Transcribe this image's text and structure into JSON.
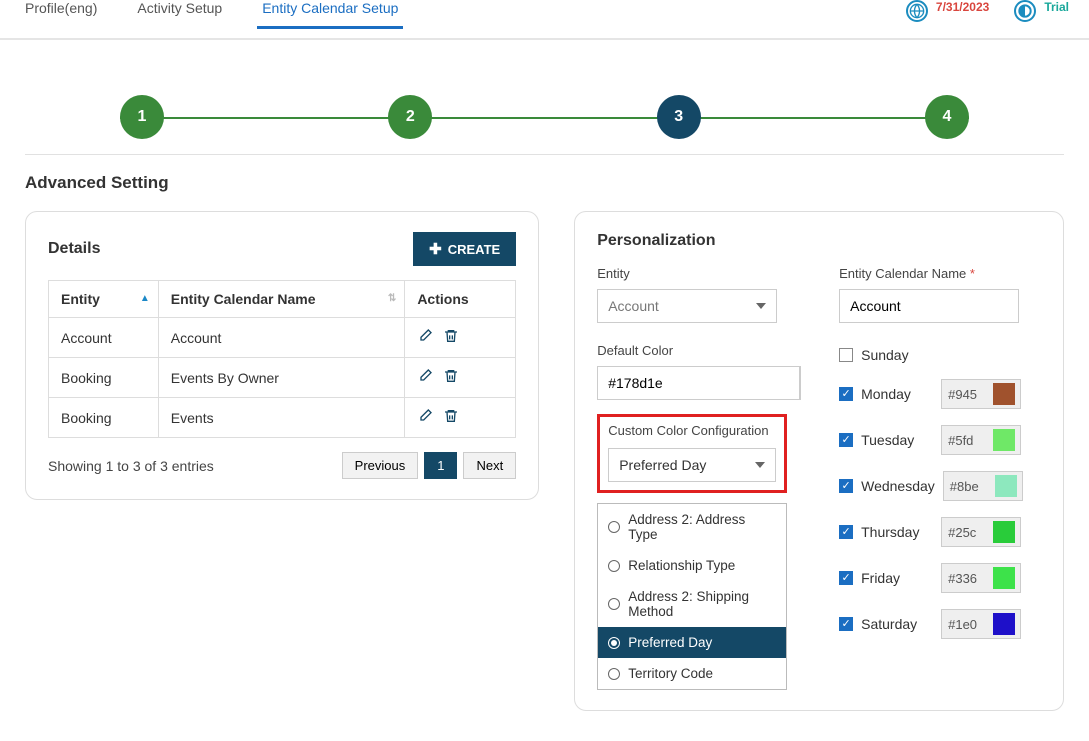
{
  "tabs": {
    "profile": "Profile(eng)",
    "activity": "Activity Setup",
    "entity": "Entity Calendar Setup"
  },
  "status": {
    "expires_value": "7/31/2023",
    "status_value": "Trial"
  },
  "steps": [
    "1",
    "2",
    "3",
    "4"
  ],
  "section_title": "Advanced Setting",
  "details": {
    "heading": "Details",
    "create_btn": "CREATE",
    "cols": {
      "entity": "Entity",
      "calname": "Entity Calendar Name",
      "actions": "Actions"
    },
    "rows": [
      {
        "entity": "Account",
        "cal": "Account"
      },
      {
        "entity": "Booking",
        "cal": "Events By Owner"
      },
      {
        "entity": "Booking",
        "cal": "Events"
      }
    ],
    "info": "Showing 1 to 3 of 3 entries",
    "pager": {
      "prev": "Previous",
      "page": "1",
      "next": "Next"
    }
  },
  "pers": {
    "heading": "Personalization",
    "entity_label": "Entity",
    "entity_value": "Account",
    "calname_label": "Entity Calendar Name",
    "calname_value": "Account",
    "defcolor_label": "Default Color",
    "defcolor_value": "#178d1e",
    "custom_label": "Custom Color Configuration",
    "custom_value": "Preferred Day",
    "options": [
      {
        "label": "Address 2: Address Type",
        "selected": false
      },
      {
        "label": "Relationship Type",
        "selected": false
      },
      {
        "label": "Address 2: Shipping Method",
        "selected": false
      },
      {
        "label": "Preferred Day",
        "selected": true
      },
      {
        "label": "Territory Code",
        "selected": false
      }
    ],
    "days": [
      {
        "name": "Sunday",
        "checked": false,
        "color": "",
        "swatch": ""
      },
      {
        "name": "Monday",
        "checked": true,
        "color": "#945",
        "swatch": "#a0522d"
      },
      {
        "name": "Tuesday",
        "checked": true,
        "color": "#5fd",
        "swatch": "#6fe867"
      },
      {
        "name": "Wednesday",
        "checked": true,
        "color": "#8be",
        "swatch": "#8de8be"
      },
      {
        "name": "Thursday",
        "checked": true,
        "color": "#25c",
        "swatch": "#29cc3a"
      },
      {
        "name": "Friday",
        "checked": true,
        "color": "#336",
        "swatch": "#3de24a"
      },
      {
        "name": "Saturday",
        "checked": true,
        "color": "#1e0",
        "swatch": "#1e10c9"
      }
    ]
  }
}
